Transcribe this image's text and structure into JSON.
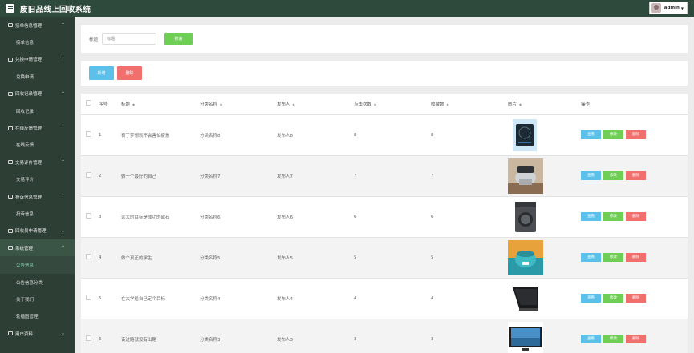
{
  "app": {
    "title": "废旧品线上回收系统",
    "user": "admin"
  },
  "sidebar": [
    {
      "label": "接单信息管理",
      "chevron": "^",
      "subs": [
        {
          "label": "接单信息"
        }
      ]
    },
    {
      "label": "兑换申请管理",
      "chevron": "^",
      "subs": [
        {
          "label": "兑换申请"
        }
      ]
    },
    {
      "label": "回收记录管理",
      "chevron": "^",
      "subs": [
        {
          "label": "回收记录"
        }
      ]
    },
    {
      "label": "在线反馈管理",
      "chevron": "^",
      "subs": [
        {
          "label": "在线反馈"
        }
      ]
    },
    {
      "label": "交易评价管理",
      "chevron": "^",
      "subs": [
        {
          "label": "交易评价"
        }
      ]
    },
    {
      "label": "投诉信息管理",
      "chevron": "^",
      "subs": [
        {
          "label": "投诉信息"
        }
      ]
    },
    {
      "label": "回收员申请管理",
      "chevron": "v",
      "subs": []
    },
    {
      "label": "系统管理",
      "chevron": "^",
      "active": true,
      "subs": [
        {
          "label": "公告信息",
          "active": true
        },
        {
          "label": "公告信息分类"
        },
        {
          "label": "关于我们"
        },
        {
          "label": "轮播图管理"
        }
      ]
    },
    {
      "label": "用户资料",
      "chevron": "v",
      "subs": []
    }
  ],
  "search": {
    "label": "标题",
    "placeholder": "标题",
    "button": "搜索"
  },
  "actions": {
    "add": "新增",
    "delete": "删除"
  },
  "table": {
    "headers": {
      "index": "序号",
      "title": "标题",
      "category": "分类名称",
      "publisher": "发布人",
      "clicks": "点击次数",
      "favorites": "收藏数",
      "image": "图片",
      "ops": "操作"
    },
    "row_ops": {
      "view": "查看",
      "edit": "修改",
      "delete": "删除"
    },
    "rows": [
      {
        "index": "1",
        "title": "有了梦想就不会害怕疲惫",
        "category": "分类名称8",
        "publisher": "发布人8",
        "clicks": "8",
        "favorites": "8",
        "image": "induction-cooker"
      },
      {
        "index": "2",
        "title": "做一个最好的自己",
        "category": "分类名称7",
        "publisher": "发布人7",
        "clicks": "7",
        "favorites": "7",
        "image": "stand-mixer"
      },
      {
        "index": "3",
        "title": "远大的目标是成功的磁石",
        "category": "分类名称6",
        "publisher": "发布人6",
        "clicks": "6",
        "favorites": "6",
        "image": "washing-machine"
      },
      {
        "index": "4",
        "title": "做个真正的学生",
        "category": "分类名称5",
        "publisher": "发布人5",
        "clicks": "5",
        "favorites": "5",
        "image": "rice-cooker"
      },
      {
        "index": "5",
        "title": "在大学给自己定个目标",
        "category": "分类名称4",
        "publisher": "发布人4",
        "clicks": "4",
        "favorites": "4",
        "image": "range-hood"
      },
      {
        "index": "6",
        "title": "奋进路就没有出路",
        "category": "分类名称3",
        "publisher": "发布人3",
        "clicks": "3",
        "favorites": "3",
        "image": "television"
      }
    ]
  },
  "colors": {
    "topbar": "#2e4a3c",
    "sidebar": "#2d3f35",
    "blue": "#5bc0ea",
    "green": "#6fcf55",
    "red": "#f1706e"
  }
}
